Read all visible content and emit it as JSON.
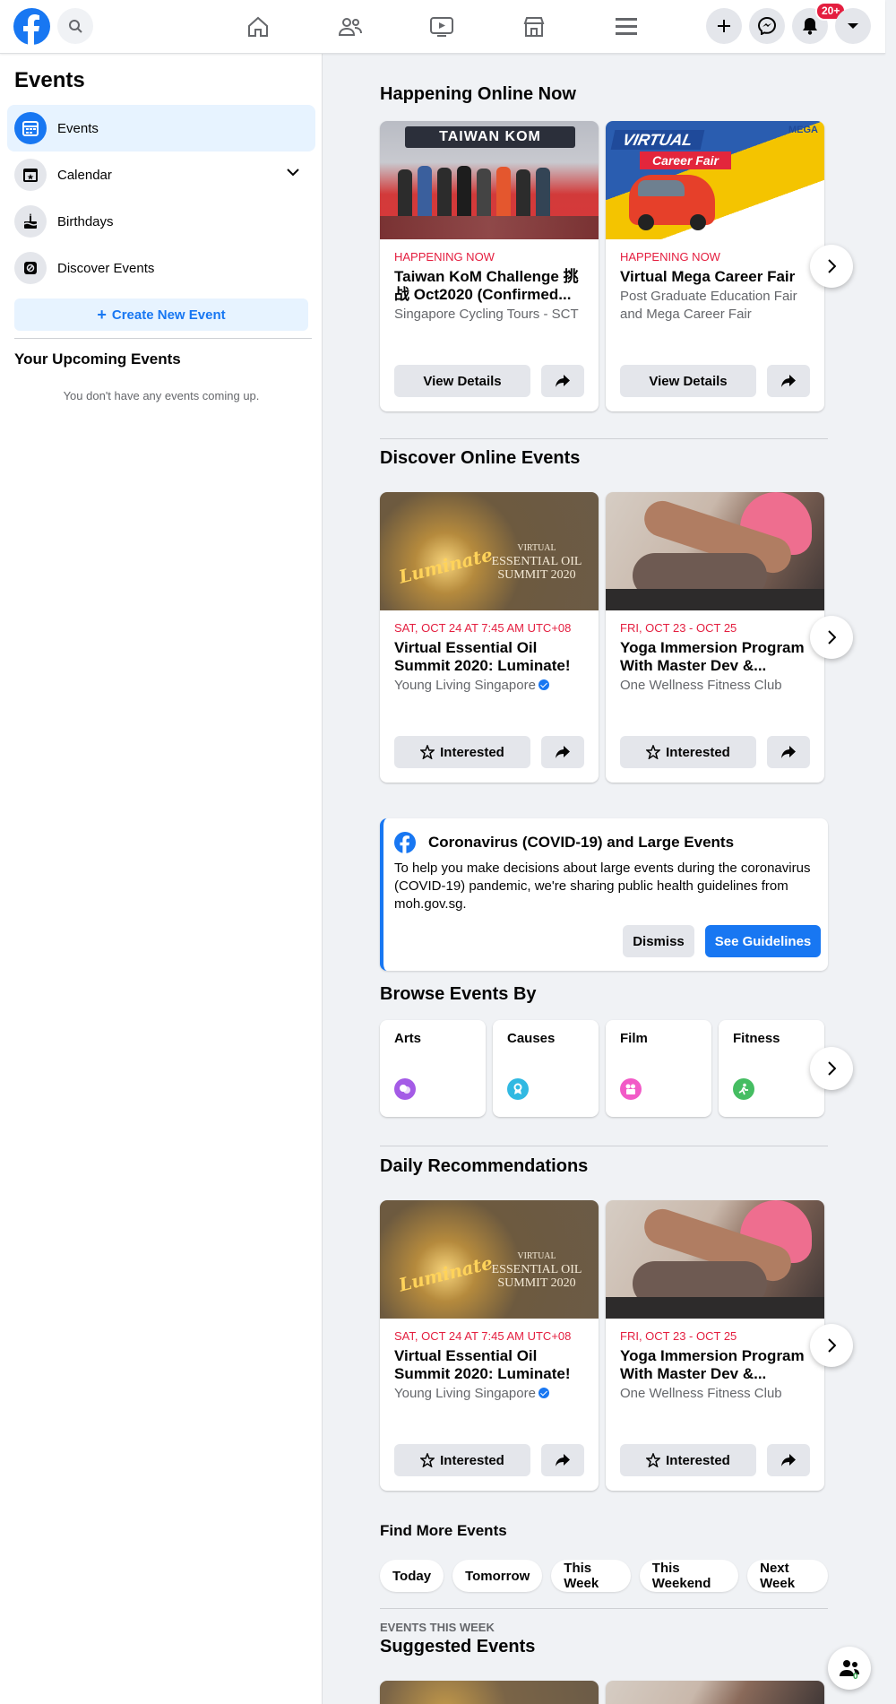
{
  "topbar": {
    "notification_count": "20+"
  },
  "sidebar": {
    "title": "Events",
    "items": [
      {
        "label": "Events"
      },
      {
        "label": "Calendar"
      },
      {
        "label": "Birthdays"
      },
      {
        "label": "Discover Events"
      }
    ],
    "create_label": "Create New Event",
    "upcoming_title": "Your Upcoming Events",
    "upcoming_empty": "You don't have any events coming up."
  },
  "happening": {
    "title": "Happening Online Now",
    "cards": [
      {
        "date": "HAPPENING NOW",
        "title": "Taiwan KoM Challenge 挑战 Oct2020 (Confirmed...",
        "sub": "Singapore Cycling Tours - SCT",
        "action": "View Details",
        "banner_text": "TAIWAN KOM"
      },
      {
        "date": "HAPPENING NOW",
        "title": "Virtual Mega Career Fair",
        "sub": "Post Graduate Education Fair and Mega Career Fair",
        "action": "View Details",
        "banner_text": "VIRTUAL",
        "banner_text2": "Career Fair",
        "banner_text3": "MEGA"
      }
    ]
  },
  "discover": {
    "title": "Discover Online Events",
    "cards": [
      {
        "date": "SAT, OCT 24 AT 7:45 AM UTC+08",
        "title": "Virtual Essential Oil Summit 2020: Luminate!",
        "sub": "Young Living Singapore",
        "action": "Interested",
        "img_line1": "VIRTUAL",
        "img_line2": "ESSENTIAL OIL",
        "img_line3": "SUMMIT 2020",
        "img_script": "Luminate"
      },
      {
        "date": "FRI, OCT 23 - OCT 25",
        "title": "Yoga Immersion Program With Master Dev &...",
        "sub": "One Wellness Fitness Club",
        "action": "Interested"
      }
    ]
  },
  "covid": {
    "title": "Coronavirus (COVID-19) and Large Events",
    "text": "To help you make decisions about large events during the coronavirus (COVID-19) pandemic, we're sharing public health guidelines from moh.gov.sg.",
    "dismiss": "Dismiss",
    "guidelines": "See Guidelines"
  },
  "browse": {
    "title": "Browse Events By",
    "categories": [
      {
        "label": "Arts",
        "color": "#a45be6"
      },
      {
        "label": "Causes",
        "color": "#31b9e2"
      },
      {
        "label": "Film",
        "color": "#f25ac7"
      },
      {
        "label": "Fitness",
        "color": "#45bd62"
      }
    ]
  },
  "daily": {
    "title": "Daily Recommendations",
    "cards": [
      {
        "date": "SAT, OCT 24 AT 7:45 AM UTC+08",
        "title": "Virtual Essential Oil Summit 2020: Luminate!",
        "sub": "Young Living Singapore",
        "action": "Interested",
        "img_line1": "VIRTUAL",
        "img_line2": "ESSENTIAL OIL",
        "img_line3": "SUMMIT 2020",
        "img_script": "Luminate"
      },
      {
        "date": "FRI, OCT 23 - OCT 25",
        "title": "Yoga Immersion Program With Master Dev &...",
        "sub": "One Wellness Fitness Club",
        "action": "Interested"
      }
    ]
  },
  "find_more": {
    "title": "Find More Events",
    "chips": [
      "Today",
      "Tomorrow",
      "This Week",
      "This Weekend",
      "Next Week"
    ]
  },
  "suggested": {
    "kicker": "EVENTS THIS WEEK",
    "title": "Suggested Events"
  },
  "chat": {
    "count": "0"
  },
  "colors": {
    "accent": "#1877f2",
    "date_red": "#e41e3f",
    "background": "#f0f2f5"
  }
}
